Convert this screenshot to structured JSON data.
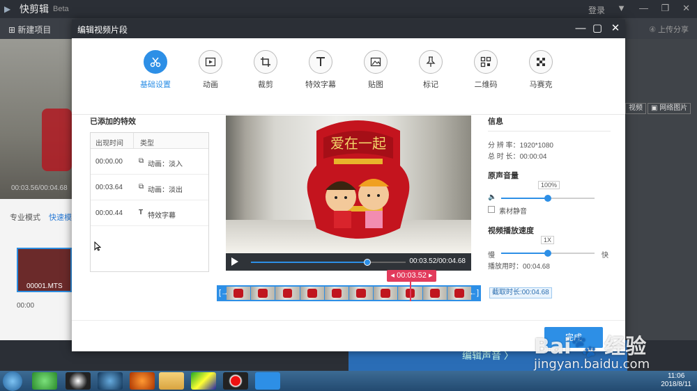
{
  "app": {
    "name": "快剪辑",
    "beta": "Beta",
    "login": "登录",
    "new_project": "新建项目",
    "upload_share": "上传分享",
    "bg_time": "00:03.56/00:04.68",
    "network_image": "网络图片",
    "bg_video_btn": "视频",
    "mode_pro": "专业模式",
    "mode_fast": "快速模",
    "clip_name": "00001.MTS",
    "timeline_zero": "00:00",
    "edit_audio": "编辑声音 〉"
  },
  "modal": {
    "title": "编辑视频片段",
    "tools": [
      {
        "label": "基础设置",
        "icon": "scissors-icon",
        "active": true
      },
      {
        "label": "动画",
        "icon": "play-box-icon"
      },
      {
        "label": "裁剪",
        "icon": "crop-icon"
      },
      {
        "label": "特效字幕",
        "icon": "text-icon"
      },
      {
        "label": "贴图",
        "icon": "image-icon"
      },
      {
        "label": "标记",
        "icon": "pin-icon"
      },
      {
        "label": "二维码",
        "icon": "qrcode-icon"
      },
      {
        "label": "马赛克",
        "icon": "mosaic-icon"
      }
    ],
    "effects": {
      "title": "已添加的特效",
      "col_time": "出现时间",
      "col_type": "类型",
      "rows": [
        {
          "time": "00:00.00",
          "icon": "⧉",
          "type": "动画：淡入"
        },
        {
          "time": "00:03.64",
          "icon": "⧉",
          "type": "动画：淡出"
        },
        {
          "time": "00:00.44",
          "icon": "T",
          "type": "特效字幕"
        }
      ]
    },
    "video": {
      "time": "00:03.52/00:04.68",
      "progress": 0.75,
      "caption": "爱在一起"
    },
    "strip": {
      "current": "00:03.52",
      "cut_length": "截取时长:00:04.68",
      "frames": 10
    },
    "info": {
      "title": "信息",
      "resolution_label": "分 辨 率：",
      "resolution": "1920*1080",
      "duration_label": "总 时 长：",
      "duration": "00:00:04"
    },
    "volume": {
      "title": "原声音量",
      "value": "100%",
      "level": 0.5,
      "mute_label": "素材静音"
    },
    "speed": {
      "title": "视频播放速度",
      "value": "1X",
      "level": 0.5,
      "slow": "慢",
      "fast": "快",
      "play_time_label": "播放用时：",
      "play_time": "00:04.68"
    },
    "done": "完成"
  },
  "watermark": {
    "text": "Bai",
    "text2": "经验",
    "url": "jingyan.baidu.com"
  },
  "taskbar": {
    "time": "11:06",
    "date": "2018/8/11"
  }
}
